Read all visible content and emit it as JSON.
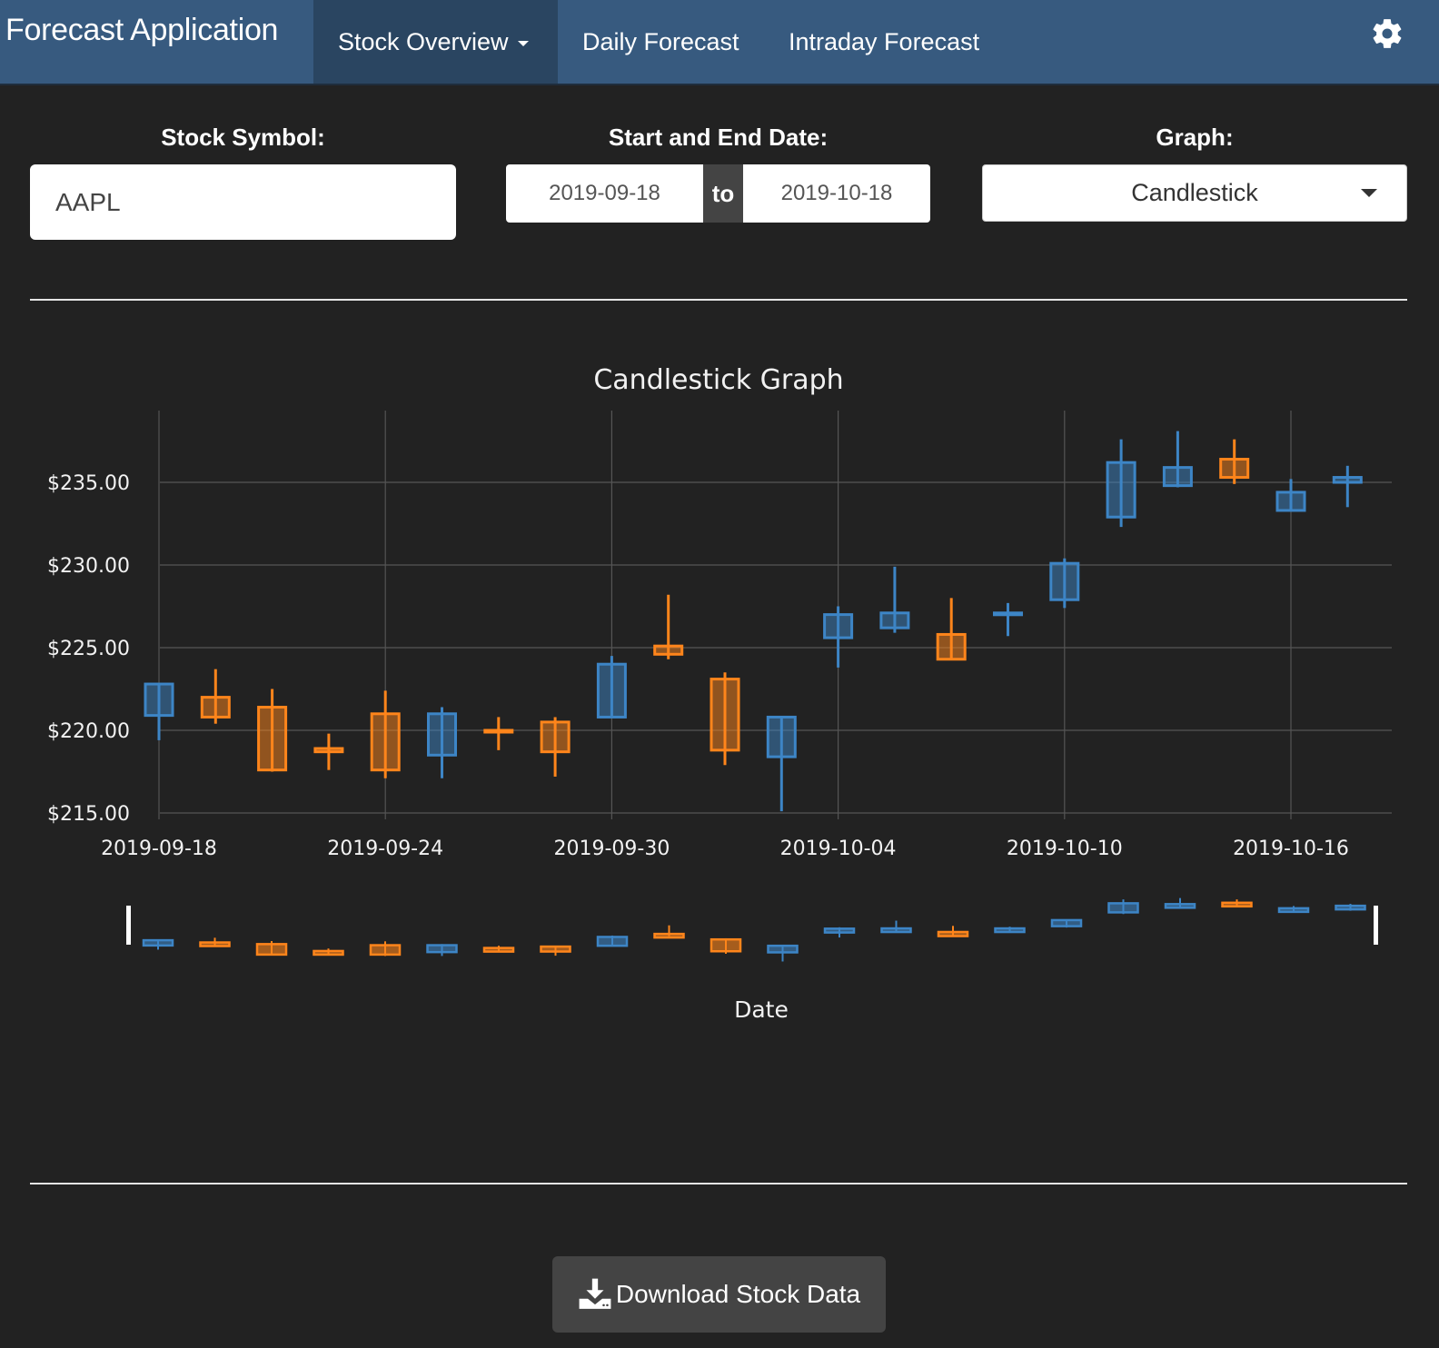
{
  "navbar": {
    "brand": "Forecast Application",
    "items": [
      {
        "label": "Stock Overview",
        "active": true,
        "dropdown": true
      },
      {
        "label": "Daily Forecast",
        "active": false
      },
      {
        "label": "Intraday Forecast",
        "active": false
      }
    ],
    "settings_icon": "gear-icon"
  },
  "controls": {
    "symbol_label": "Stock Symbol:",
    "symbol_value": "AAPL",
    "date_label": "Start and End Date:",
    "start_date": "2019-09-18",
    "date_separator": "to",
    "end_date": "2019-10-18",
    "graph_label": "Graph:",
    "graph_value": "Candlestick"
  },
  "download": {
    "label": "Download Stock Data",
    "icon": "download-icon"
  },
  "colors": {
    "navbar": "#375a7f",
    "background": "#222222",
    "increasing": "#3d85c6",
    "decreasing": "#ff851b"
  },
  "chart_data": {
    "type": "candlestick",
    "title": "Candlestick Graph",
    "xlabel": "Date",
    "ylabel": "",
    "ylim": [
      214.6,
      239.3
    ],
    "yticks": [
      215,
      220,
      225,
      230,
      235
    ],
    "ytick_labels": [
      "$215.00",
      "$220.00",
      "$225.00",
      "$230.00",
      "$235.00"
    ],
    "xtick_labels": [
      "2019-09-18",
      "2019-09-24",
      "2019-09-30",
      "2019-10-04",
      "2019-10-10",
      "2019-10-16"
    ],
    "grid": true,
    "legend": "none",
    "rangeslider": true,
    "x": [
      "2019-09-18",
      "2019-09-19",
      "2019-09-20",
      "2019-09-23",
      "2019-09-24",
      "2019-09-25",
      "2019-09-26",
      "2019-09-27",
      "2019-09-30",
      "2019-10-01",
      "2019-10-02",
      "2019-10-03",
      "2019-10-04",
      "2019-10-07",
      "2019-10-08",
      "2019-10-09",
      "2019-10-10",
      "2019-10-11",
      "2019-10-14",
      "2019-10-15",
      "2019-10-16",
      "2019-10-17"
    ],
    "open": [
      220.9,
      222.0,
      221.4,
      218.9,
      221.0,
      218.5,
      220.0,
      220.5,
      220.8,
      225.1,
      223.1,
      218.4,
      225.6,
      226.2,
      225.8,
      227.0,
      227.9,
      232.9,
      234.8,
      236.4,
      233.3,
      235.0
    ],
    "high": [
      222.8,
      223.7,
      222.5,
      219.8,
      222.4,
      221.4,
      220.8,
      220.8,
      224.5,
      228.2,
      223.5,
      220.8,
      227.5,
      229.9,
      228.0,
      227.7,
      230.4,
      237.6,
      238.1,
      237.6,
      235.2,
      236.0
    ],
    "low": [
      219.4,
      220.4,
      217.5,
      217.6,
      217.1,
      217.1,
      218.8,
      217.2,
      220.8,
      224.3,
      217.9,
      215.1,
      223.8,
      225.9,
      224.3,
      225.7,
      227.4,
      232.3,
      234.7,
      234.9,
      233.3,
      233.5
    ],
    "close": [
      222.8,
      220.8,
      217.6,
      218.7,
      217.6,
      221.0,
      219.9,
      218.7,
      224.0,
      224.6,
      218.8,
      220.8,
      227.0,
      227.1,
      224.3,
      227.1,
      230.1,
      236.2,
      235.9,
      235.3,
      234.4,
      235.3
    ]
  }
}
